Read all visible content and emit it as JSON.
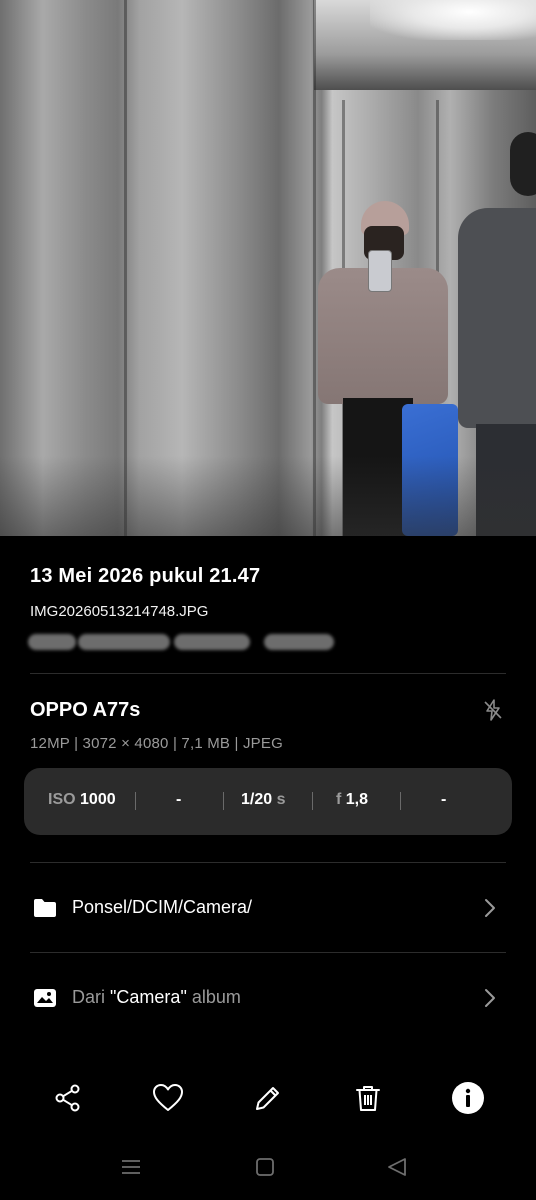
{
  "photo": {
    "alt": "Mirror selfie in an elevator"
  },
  "details": {
    "date": "13 Mei 2026 pukul 21.47",
    "filename": "IMG20260513214748.JPG",
    "device": "OPPO A77s",
    "specs": "12MP | 3072 × 4080 | 7,1 MB | JPEG"
  },
  "exif": {
    "iso_label": "ISO",
    "iso_value": "1000",
    "exposure_comp": "-",
    "shutter_value": "1/20",
    "shutter_unit": "s",
    "aperture_label": "f",
    "aperture_value": "1,8",
    "focal": "-"
  },
  "folder": {
    "path": "Ponsel/DCIM/Camera/"
  },
  "album": {
    "prefix": "Dari",
    "name": "\"Camera\"",
    "suffix": "album"
  },
  "toolbar": [
    "share-icon",
    "favorite-icon",
    "edit-icon",
    "delete-icon",
    "info-icon"
  ],
  "navbar": [
    "menu-icon",
    "home-icon",
    "back-icon"
  ],
  "colors": {
    "background": "#000000",
    "panel": "#2b2b2b",
    "secondary_text": "#9a9a9a"
  }
}
